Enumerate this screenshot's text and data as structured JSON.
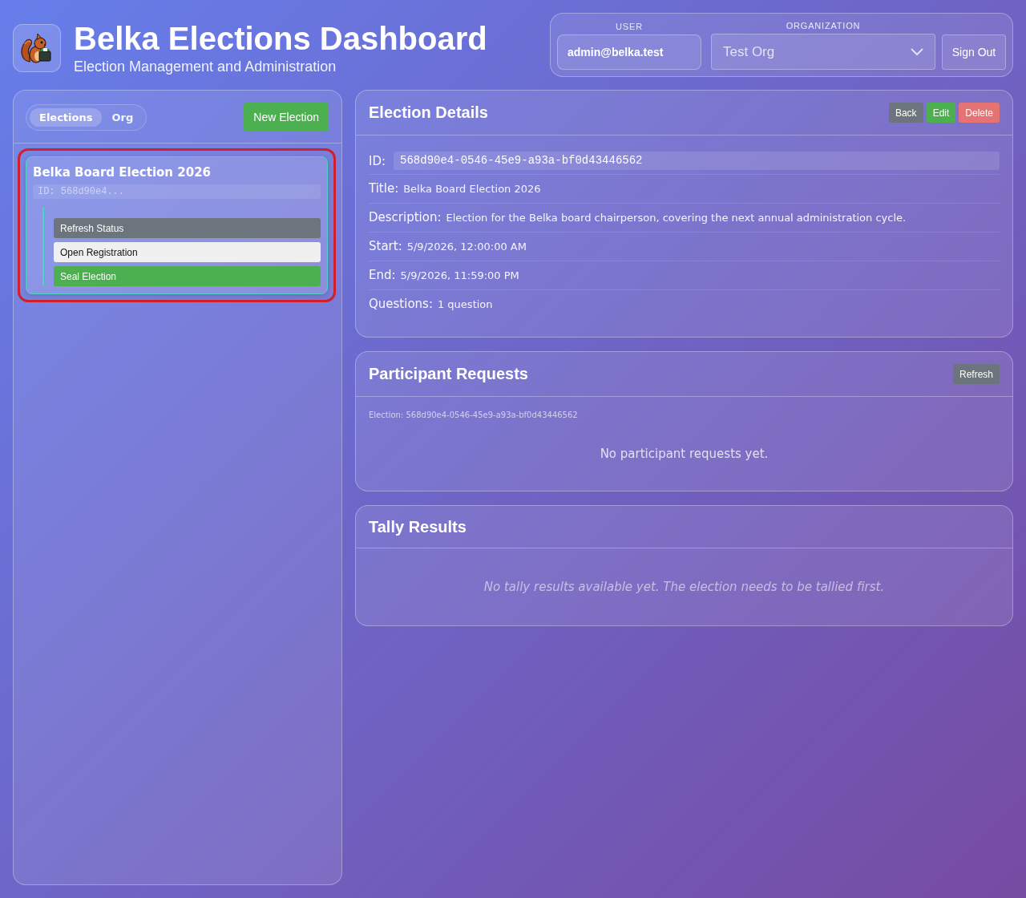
{
  "header": {
    "title": "Belka Elections Dashboard",
    "subtitle": "Election Management and Administration"
  },
  "account": {
    "user_label": "USER",
    "user": "admin@belka.test",
    "organization_label": "ORGANIZATION",
    "organization": "Test Org",
    "sign_out": "Sign Out"
  },
  "sidebar": {
    "tabs": [
      {
        "label": "Elections",
        "selected": true
      },
      {
        "label": "Org",
        "selected": false
      }
    ],
    "new_election": "New Election",
    "elections": [
      {
        "title": "Belka Board Election 2026",
        "id": "ID: 568d90e4...",
        "selected": true,
        "focused": true,
        "actions": [
          {
            "label": "Refresh Status",
            "kind": "secondary"
          },
          {
            "label": "Open Registration",
            "kind": "light"
          },
          {
            "label": "Seal Election",
            "kind": "success"
          }
        ]
      }
    ]
  },
  "election_details": {
    "title": "Election Details",
    "buttons": [
      {
        "label": "Back",
        "kind": "secondary"
      },
      {
        "label": "Edit",
        "kind": "success"
      },
      {
        "label": "Delete",
        "kind": "danger"
      }
    ],
    "fields": [
      {
        "label": "ID:",
        "value": "568d90e4-0546-45e9-a93a-bf0d43446562",
        "kind": "code"
      },
      {
        "label": "Title:",
        "value": "Belka Board Election 2026",
        "kind": "text"
      },
      {
        "label": "Description:",
        "value": "Election for the Belka board chairperson, covering the next annual administration cycle.",
        "kind": "text"
      },
      {
        "label": "Start:",
        "value": "5/9/2026, 12:00:00 AM",
        "kind": "text"
      },
      {
        "label": "End:",
        "value": "5/9/2026, 11:59:00 PM",
        "kind": "text"
      },
      {
        "label": "Questions:",
        "value": "1 question",
        "kind": "text"
      }
    ]
  },
  "participant_requests": {
    "title": "Participant Requests",
    "refresh": "Refresh",
    "election": "Election: 568d90e4-0546-45e9-a93a-bf0d43446562",
    "empty_message": "No participant requests yet."
  },
  "tally_results": {
    "title": "Tally Results",
    "empty_message": "No tally results available yet. The election needs to be tallied first."
  }
}
